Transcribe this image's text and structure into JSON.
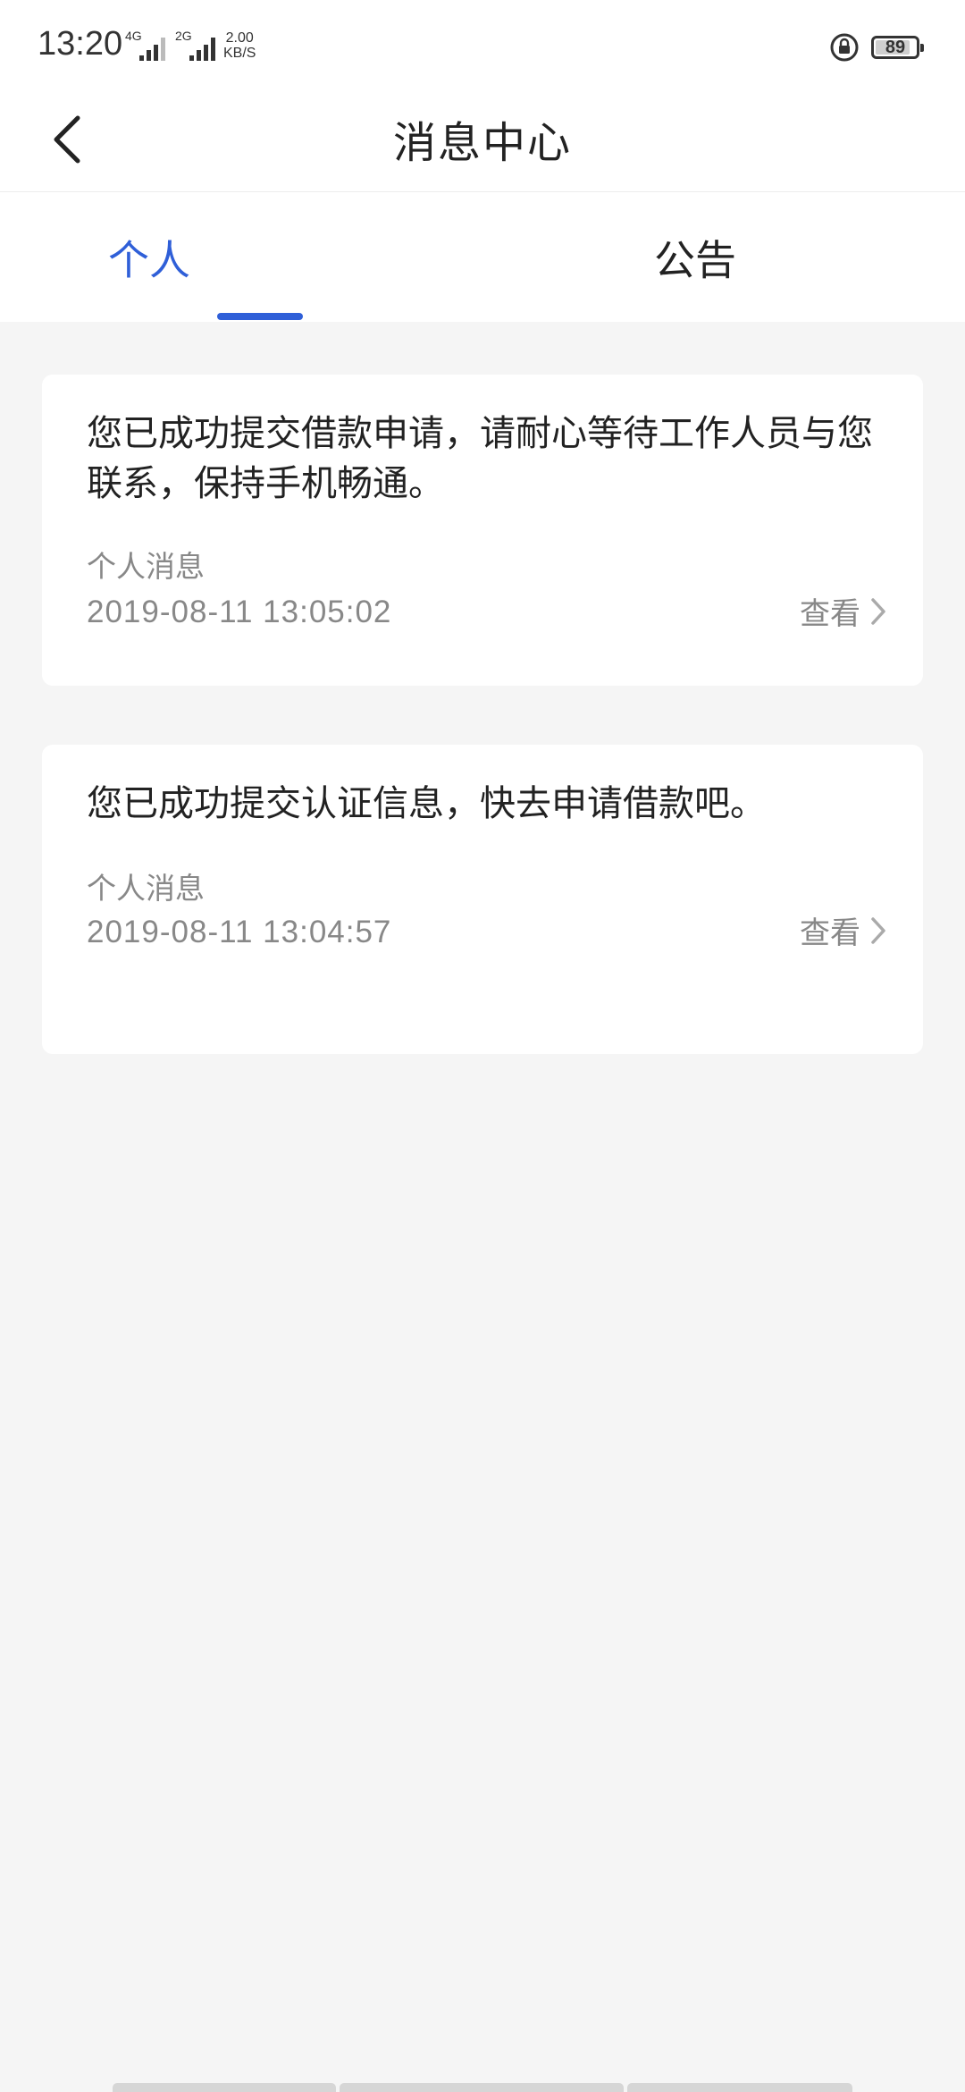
{
  "status_bar": {
    "time": "13:20",
    "network_1": "4G",
    "network_2": "2G",
    "speed_value": "2.00",
    "speed_unit": "KB/S",
    "battery": "89"
  },
  "nav": {
    "title": "消息中心"
  },
  "tabs": [
    {
      "label": "个人",
      "active": true
    },
    {
      "label": "公告",
      "active": false
    }
  ],
  "accent_color": "#2f5fd8",
  "messages": [
    {
      "text": "您已成功提交借款申请，请耐心等待工作人员与您联系，保持手机畅通。",
      "type": "个人消息",
      "time": "2019-08-11 13:05:02",
      "action": "查看"
    },
    {
      "text": "您已成功提交认证信息，快去申请借款吧。",
      "type": "个人消息",
      "time": "2019-08-11 13:04:57",
      "action": "查看"
    }
  ]
}
